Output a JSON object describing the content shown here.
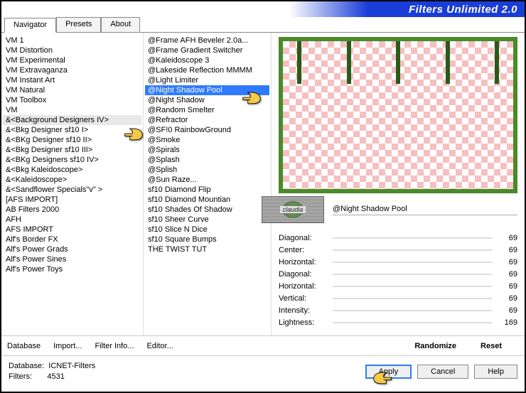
{
  "app": {
    "title": "Filters Unlimited 2.0"
  },
  "tabs": [
    {
      "label": "Navigator",
      "active": true
    },
    {
      "label": "Presets",
      "active": false
    },
    {
      "label": "About",
      "active": false
    }
  ],
  "leftList": [
    "VM 1",
    "VM Distortion",
    "VM Experimental",
    "VM Extravaganza",
    "VM Instant Art",
    "VM Natural",
    "VM Toolbox",
    "VM",
    "&<Background Designers IV>",
    "&<Bkg Designer sf10 I>",
    "&<BKg Designer sf10 II>",
    "&<Bkg Designer sf10 III>",
    "&<BKg Designers sf10 IV>",
    "&<Bkg Kaleidoscope>",
    "&<Kaleidoscope>",
    "&<Sandflower Specials\"v\" >",
    "[AFS IMPORT]",
    "AB Filters 2000",
    "AFH",
    "AFS IMPORT",
    "Alf's Border FX",
    "Alf's Power Grads",
    "Alf's Power Sines",
    "Alf's Power Toys"
  ],
  "leftSelectedIndex": 8,
  "midList": [
    "@Frame AFH Beveler 2.0a...",
    "@Frame Gradient Switcher",
    "@Kaleidoscope 3",
    "@Lakeside Reflection MMMM",
    "@Light Limiter",
    "@Night Shadow Pool",
    "@Night Shadow",
    "@Random Smelter",
    "@Refractor",
    "@SF!0 RainbowGround",
    "@Smoke",
    "@Spirals",
    "@Splash",
    "@Splish",
    "@Sun Raze...",
    "sf10 Diamond Flip",
    "sf10 Diamond Mountian",
    "sf10 Shades Of Shadow",
    "sf10 Sheer Curve",
    "sf10 Slice N Dice",
    "sf10 Square Bumps",
    "THE TWIST TUT"
  ],
  "midSelectedIndex": 5,
  "selectedFilterName": "@Night Shadow Pool",
  "logoText": "claudia",
  "sliders": [
    {
      "label": "Diagonal:",
      "value": 69
    },
    {
      "label": "Center:",
      "value": 69
    },
    {
      "label": "Horizontal:",
      "value": 69
    },
    {
      "label": "Diagonal:",
      "value": 69
    },
    {
      "label": "Horizontal:",
      "value": 69
    },
    {
      "label": "Vertical:",
      "value": 69
    },
    {
      "label": "Intensity:",
      "value": 69
    },
    {
      "label": "Lightness:",
      "value": 169
    }
  ],
  "bottomBtns": {
    "database": "Database",
    "import": "Import...",
    "filterInfo": "Filter Info...",
    "editor": "Editor...",
    "randomize": "Randomize",
    "reset": "Reset"
  },
  "status": {
    "dbLabel": "Database:",
    "dbValue": "ICNET-Filters",
    "filtersLabel": "Filters:",
    "filtersValue": "4531"
  },
  "actionBtns": {
    "apply": "Apply",
    "cancel": "Cancel",
    "help": "Help"
  }
}
